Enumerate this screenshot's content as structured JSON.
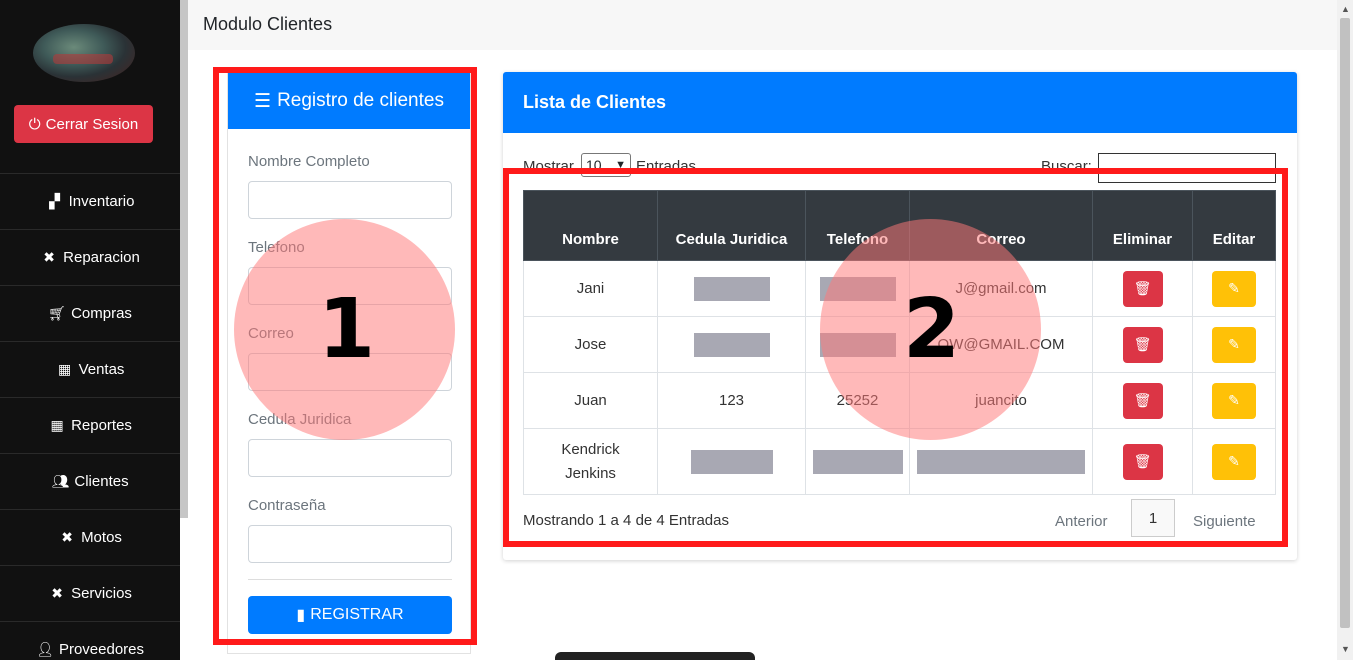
{
  "sidebar": {
    "logout_label": "Cerrar Sesion",
    "items": [
      {
        "label": "Inventario",
        "icon": "sitemap-icon"
      },
      {
        "label": "Reparacion",
        "icon": "tools-icon"
      },
      {
        "label": "Compras",
        "icon": "cart-icon"
      },
      {
        "label": "Ventas",
        "icon": "cash-register-icon"
      },
      {
        "label": "Reportes",
        "icon": "cash-register-icon"
      },
      {
        "label": "Clientes",
        "icon": "users-icon"
      },
      {
        "label": "Motos",
        "icon": "tools-icon"
      },
      {
        "label": "Servicios",
        "icon": "tools-icon"
      },
      {
        "label": "Proveedores",
        "icon": "user-tie-icon"
      }
    ]
  },
  "header": {
    "title": "Modulo Clientes"
  },
  "registration": {
    "title": "Registro de clientes",
    "fields": {
      "name_label": "Nombre Completo",
      "phone_label": "Telefono",
      "email_label": "Correo",
      "id_label": "Cedula Juridica",
      "password_label": "Contraseña"
    },
    "submit_label": "REGISTRAR"
  },
  "client_list": {
    "title": "Lista de Clientes",
    "show_prefix": "Mostrar",
    "show_value": "10",
    "show_suffix": "Entradas",
    "search_label": "Buscar:",
    "columns": [
      "Nombre",
      "Cedula Juridica",
      "Telefono",
      "Correo",
      "Eliminar",
      "Editar"
    ],
    "rows": [
      {
        "name": "Jani",
        "cedula": "",
        "telefono": "",
        "correo": "J@gmail.com"
      },
      {
        "name": "Jose",
        "cedula": "",
        "telefono": "",
        "correo": "OW@GMAIL.COM"
      },
      {
        "name": "Juan",
        "cedula": "123",
        "telefono": "25252",
        "correo": "juancito"
      },
      {
        "name": "Kendrick Jenkins",
        "cedula": "",
        "telefono": "",
        "correo": ""
      }
    ],
    "info": "Mostrando 1 a 4 de 4 Entradas",
    "pagination": {
      "prev": "Anterior",
      "current": "1",
      "next": "Siguiente"
    }
  },
  "annotations": {
    "box1": "1",
    "box2": "2"
  },
  "colors": {
    "primary": "#007bff",
    "danger": "#dc3545",
    "warning": "#ffc107",
    "sidebar": "#111111",
    "table_header": "#343a40",
    "annotation": "#ff1a1a"
  }
}
